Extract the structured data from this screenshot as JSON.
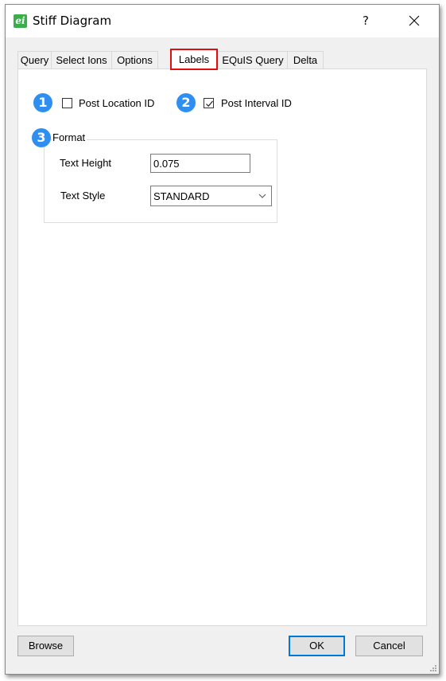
{
  "window": {
    "title": "Stiff Diagram",
    "app_icon_glyph": "ei",
    "help_label": "?",
    "close_icon": "close-icon"
  },
  "tabs": [
    {
      "label": "Query",
      "active": false
    },
    {
      "label": "Select Ions",
      "active": false
    },
    {
      "label": "Options",
      "active": false
    },
    {
      "label": "Labels",
      "active": true
    },
    {
      "label": "EQuIS Query",
      "active": false
    },
    {
      "label": "Delta",
      "active": false
    }
  ],
  "labels_tab": {
    "post_location_id": {
      "badge": "1",
      "label": "Post Location ID",
      "checked": false
    },
    "post_interval_id": {
      "badge": "2",
      "label": "Post Interval ID",
      "checked": true
    },
    "format": {
      "badge": "3",
      "legend": "Format",
      "text_height_label": "Text Height",
      "text_height_value": "0.075",
      "text_style_label": "Text Style",
      "text_style_value": "STANDARD"
    }
  },
  "footer": {
    "browse_label": "Browse",
    "ok_label": "OK",
    "cancel_label": "Cancel"
  },
  "colors": {
    "badge": "#2f8ff0",
    "highlight": "#e01010",
    "default_button_border": "#0078d7",
    "app_icon": "#3aae4a"
  }
}
